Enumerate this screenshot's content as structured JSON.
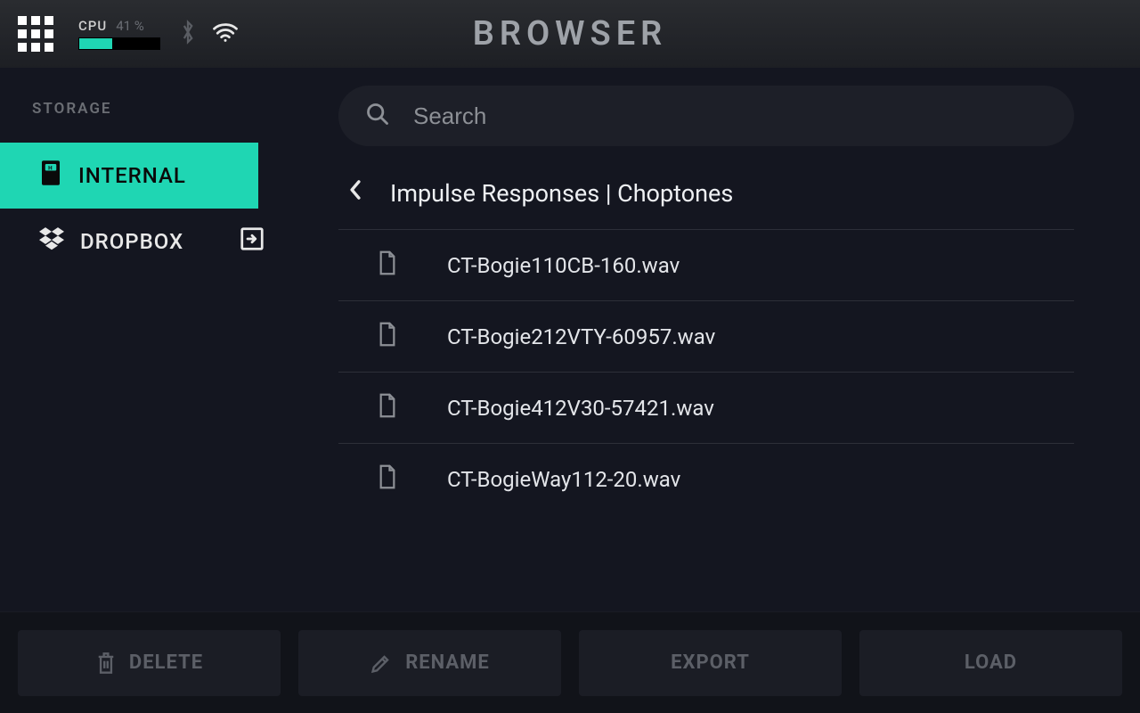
{
  "header": {
    "title": "BROWSER",
    "cpu_label": "CPU",
    "cpu_percent_text": "41 %",
    "cpu_percent_value": 41
  },
  "sidebar": {
    "heading": "STORAGE",
    "items": [
      {
        "label": "INTERNAL",
        "active": true,
        "icon": "internal-storage-icon"
      },
      {
        "label": "DROPBOX",
        "active": false,
        "icon": "dropbox-icon",
        "trailing_icon": "import-icon"
      }
    ]
  },
  "search": {
    "placeholder": "Search",
    "value": ""
  },
  "breadcrumb": {
    "path": "Impulse Responses | Choptones"
  },
  "files": [
    {
      "name": "CT-Bogie110CB-160.wav"
    },
    {
      "name": "CT-Bogie212VTY-60957.wav"
    },
    {
      "name": "CT-Bogie412V30-57421.wav"
    },
    {
      "name": "CT-BogieWay112-20.wav"
    }
  ],
  "footer": {
    "delete": "DELETE",
    "rename": "RENAME",
    "export": "EXPORT",
    "load": "LOAD"
  }
}
